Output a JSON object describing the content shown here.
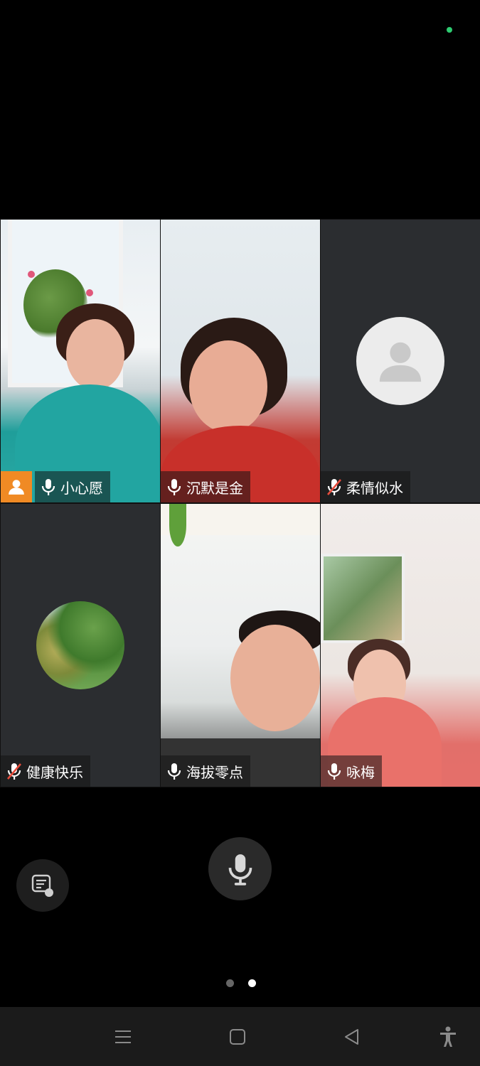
{
  "participants": [
    {
      "name": "小心愿",
      "mic": "on",
      "host": true
    },
    {
      "name": "沉默是金",
      "mic": "on",
      "host": false
    },
    {
      "name": "柔情似水",
      "mic": "off",
      "host": false
    },
    {
      "name": "健康快乐",
      "mic": "off",
      "host": false
    },
    {
      "name": "海拔零点",
      "mic": "on",
      "host": false
    },
    {
      "name": "咏梅",
      "mic": "on",
      "host": false
    }
  ],
  "pager": {
    "pages": 2,
    "current": 2
  },
  "colors": {
    "host_badge": "#f08a24",
    "status_dot": "#2ecc71"
  },
  "icons": [
    "mic-icon",
    "mic-off-icon",
    "host-person-icon",
    "chat-icon",
    "microphone-icon",
    "menu-icon",
    "home-icon",
    "back-icon",
    "accessibility-icon"
  ]
}
